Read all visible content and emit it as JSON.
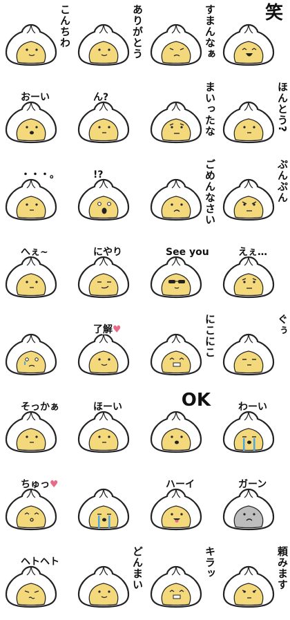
{
  "palette": {
    "filling": "#f3d97b",
    "shell": "#ffffff",
    "outline": "#222222",
    "heart": "#e86a87",
    "tears": "#4aa6e0"
  },
  "stickers": [
    {
      "caption": "こんちわ",
      "style": "v",
      "face": "smile",
      "icon": "bun-hello-icon"
    },
    {
      "caption": "ありがとう",
      "style": "v",
      "face": "smile",
      "icon": "bun-thanks-icon"
    },
    {
      "caption": "すまんなぁ",
      "style": "v",
      "face": "sorry",
      "icon": "bun-sorry-icon"
    },
    {
      "caption": "笑",
      "style": "big",
      "face": "laugh",
      "icon": "bun-laugh-icon"
    },
    {
      "caption": "おーい",
      "style": "h",
      "face": "open",
      "icon": "bun-call-icon"
    },
    {
      "caption": "ん?",
      "style": "h",
      "face": "plain",
      "icon": "bun-question-icon"
    },
    {
      "caption": "まいったな",
      "style": "v",
      "face": "troubled",
      "icon": "bun-stumped-icon"
    },
    {
      "caption": "ほんとう?",
      "style": "v",
      "face": "plain",
      "icon": "bun-really-icon"
    },
    {
      "caption": "・・・。",
      "style": "h",
      "face": "plain",
      "icon": "bun-silence-icon"
    },
    {
      "caption": "!?",
      "style": "h",
      "face": "shock",
      "icon": "bun-surprise-icon"
    },
    {
      "caption": "ごめんなさい",
      "style": "v",
      "face": "sad",
      "icon": "bun-apology-icon"
    },
    {
      "caption": "ぷんぷん",
      "style": "v",
      "face": "angry",
      "icon": "bun-angry-icon"
    },
    {
      "caption": "へぇ~",
      "style": "h",
      "face": "plain",
      "icon": "bun-huh-icon"
    },
    {
      "caption": "にやり",
      "style": "h",
      "face": "smirk",
      "icon": "bun-smirk-icon"
    },
    {
      "caption": "See you",
      "style": "h",
      "face": "shades",
      "icon": "bun-seeyou-icon"
    },
    {
      "caption": "えぇ…",
      "style": "h",
      "face": "troubled",
      "icon": "bun-eh-icon"
    },
    {
      "caption": "",
      "style": "h",
      "face": "cry",
      "icon": "bun-scared-icon"
    },
    {
      "caption": "了解",
      "style": "h",
      "face": "smile",
      "icon": "bun-roger-icon",
      "heart": "♥"
    },
    {
      "caption": "にこにこ",
      "style": "v",
      "face": "grin",
      "icon": "bun-beaming-icon"
    },
    {
      "caption": "ぐぅ",
      "style": "v",
      "face": "sleep",
      "icon": "bun-sleep-icon"
    },
    {
      "caption": "そっかぁ",
      "style": "h",
      "face": "plain",
      "icon": "bun-isee-icon"
    },
    {
      "caption": "ほーい",
      "style": "h",
      "face": "plain",
      "icon": "bun-okay-icon"
    },
    {
      "caption": "OK",
      "style": "big",
      "face": "open",
      "icon": "bun-ok-icon"
    },
    {
      "caption": "わーい",
      "style": "h",
      "face": "tears",
      "icon": "bun-yay-icon"
    },
    {
      "caption": "ちゅっ",
      "style": "h",
      "face": "kiss",
      "icon": "bun-kiss-icon",
      "heart": "♥"
    },
    {
      "caption": "",
      "style": "h",
      "face": "tears",
      "icon": "bun-crying-icon"
    },
    {
      "caption": "ハーイ",
      "style": "h",
      "face": "tongue",
      "icon": "bun-hi-icon"
    },
    {
      "caption": "ガーン",
      "style": "h",
      "face": "shockgray",
      "icon": "bun-shocked-icon"
    },
    {
      "caption": "ヘトヘト",
      "style": "h",
      "face": "tired",
      "icon": "bun-tired-icon"
    },
    {
      "caption": "どんまい",
      "style": "v",
      "face": "smile",
      "icon": "bun-dontmind-icon"
    },
    {
      "caption": "キラッ",
      "style": "v",
      "face": "grin",
      "icon": "bun-sparkle-icon"
    },
    {
      "caption": "頼みます",
      "style": "v",
      "face": "plead",
      "icon": "bun-please-icon"
    }
  ]
}
